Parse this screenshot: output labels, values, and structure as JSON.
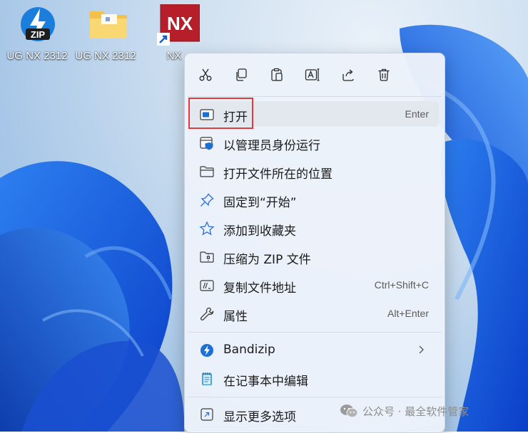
{
  "desktop": {
    "icons": [
      {
        "label": "UG NX 2312",
        "icon": "zip-archive-icon",
        "badge": "ZIP"
      },
      {
        "label": "UG NX 2312",
        "icon": "folder-icon"
      },
      {
        "label": "NX",
        "icon": "nx-app-shortcut-icon",
        "badge": "NX"
      }
    ]
  },
  "context_menu": {
    "toolbar": [
      {
        "name": "cut",
        "icon": "scissors-icon"
      },
      {
        "name": "copy",
        "icon": "copy-icon"
      },
      {
        "name": "paste",
        "icon": "clipboard-icon"
      },
      {
        "name": "rename",
        "icon": "rename-icon"
      },
      {
        "name": "share",
        "icon": "share-icon"
      },
      {
        "name": "delete",
        "icon": "trash-icon"
      }
    ],
    "items": [
      {
        "label": "打开",
        "shortcut": "Enter",
        "icon": "window-icon",
        "highlighted": true
      },
      {
        "label": "以管理员身份运行",
        "icon": "admin-shield-icon"
      },
      {
        "label": "打开文件所在的位置",
        "icon": "folder-outline-icon"
      },
      {
        "label": "固定到“开始”",
        "icon": "pin-icon"
      },
      {
        "label": "添加到收藏夹",
        "icon": "star-icon"
      },
      {
        "label": "压缩为 ZIP 文件",
        "icon": "zip-folder-icon"
      },
      {
        "label": "复制文件地址",
        "shortcut": "Ctrl+Shift+C",
        "icon": "path-copy-icon"
      },
      {
        "label": "属性",
        "shortcut": "Alt+Enter",
        "icon": "wrench-icon"
      },
      {
        "label": "Bandizip",
        "icon": "bandizip-icon",
        "submenu": true
      },
      {
        "label": "在记事本中编辑",
        "icon": "notepad-icon"
      },
      {
        "label": "显示更多选项",
        "icon": "more-options-icon"
      }
    ]
  },
  "watermark": {
    "text": "公众号 · 最全软件管家",
    "icon": "wechat-icon"
  },
  "colors": {
    "accent": "#0067c0",
    "highlight_box": "#e0393e",
    "menu_bg": "#ecf2fa"
  }
}
